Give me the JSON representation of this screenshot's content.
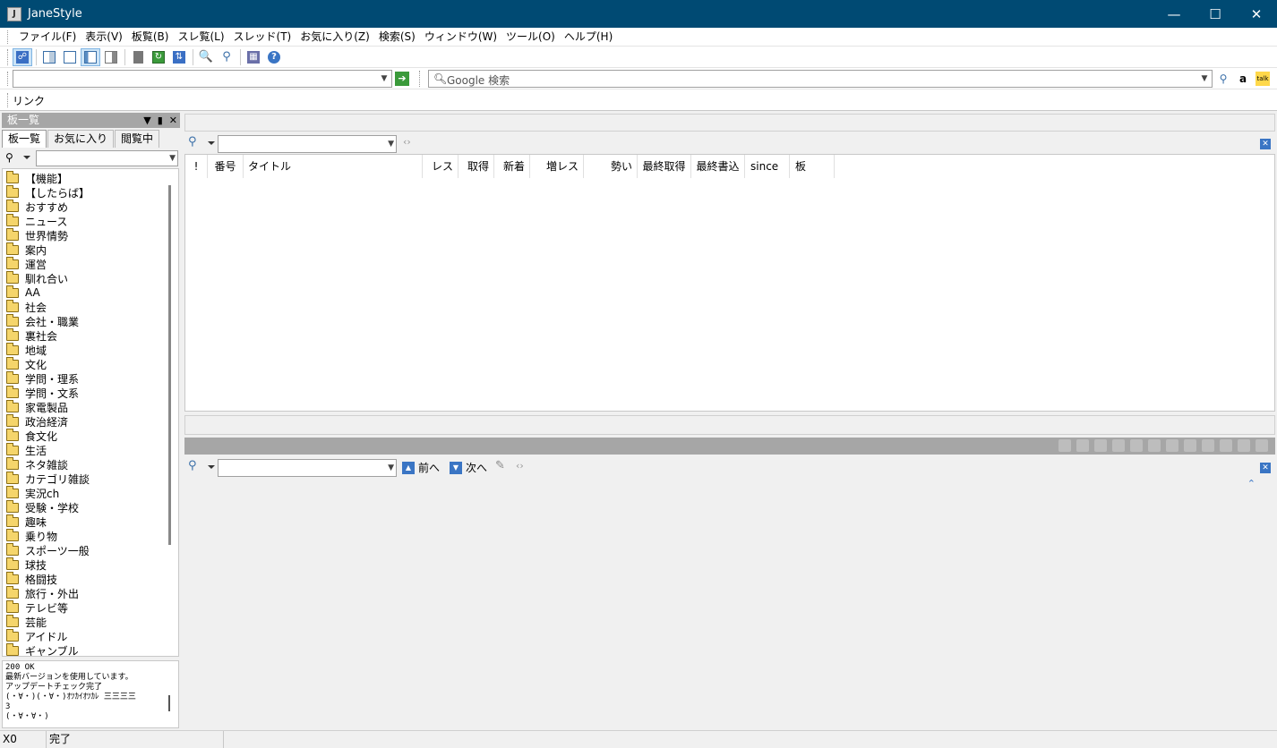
{
  "window": {
    "title": "JaneStyle"
  },
  "menu": [
    "ファイル(F)",
    "表示(V)",
    "板覧(B)",
    "スレ覧(L)",
    "スレッド(T)",
    "お気に入り(Z)",
    "検索(S)",
    "ウィンドウ(W)",
    "ツール(O)",
    "ヘルプ(H)"
  ],
  "address": {
    "url_value": "",
    "search_placeholder": "Google 検索"
  },
  "links": {
    "label": "リンク"
  },
  "left_panel": {
    "title": "板一覧",
    "tabs": [
      "板一覧",
      "お気に入り",
      "閲覧中"
    ],
    "active_tab": 0,
    "boards": [
      "【機能】",
      "【したらば】",
      "おすすめ",
      "ニュース",
      "世界情勢",
      "案内",
      "運営",
      "馴れ合い",
      "AA",
      "社会",
      "会社・職業",
      "裏社会",
      "地域",
      "文化",
      "学問・理系",
      "学問・文系",
      "家電製品",
      "政治経済",
      "食文化",
      "生活",
      "ネタ雑談",
      "カテゴリ雑談",
      "実況ch",
      "受験・学校",
      "趣味",
      "乗り物",
      "スポーツ一般",
      "球技",
      "格闘技",
      "旅行・外出",
      "テレビ等",
      "芸能",
      "アイドル",
      "ギャンブル"
    ]
  },
  "log": {
    "lines": [
      "200 OK",
      "最新バージョンを使用しています。",
      "アップデートチェック完了",
      "(・∀・)(・∀・)ｵﾂｶｲｵﾂｶﾚ 三三三三",
      "3",
      "(・∀・∀・)"
    ]
  },
  "thread_list": {
    "columns": [
      "!",
      "番号",
      "タイトル",
      "レス",
      "取得",
      "新着",
      "増レス",
      "勢い",
      "最終取得",
      "最終書込",
      "since",
      "板"
    ]
  },
  "thread_view": {
    "prev_label": "前へ",
    "next_label": "次へ"
  },
  "status": {
    "cell1": "X0",
    "cell2": "完了"
  }
}
